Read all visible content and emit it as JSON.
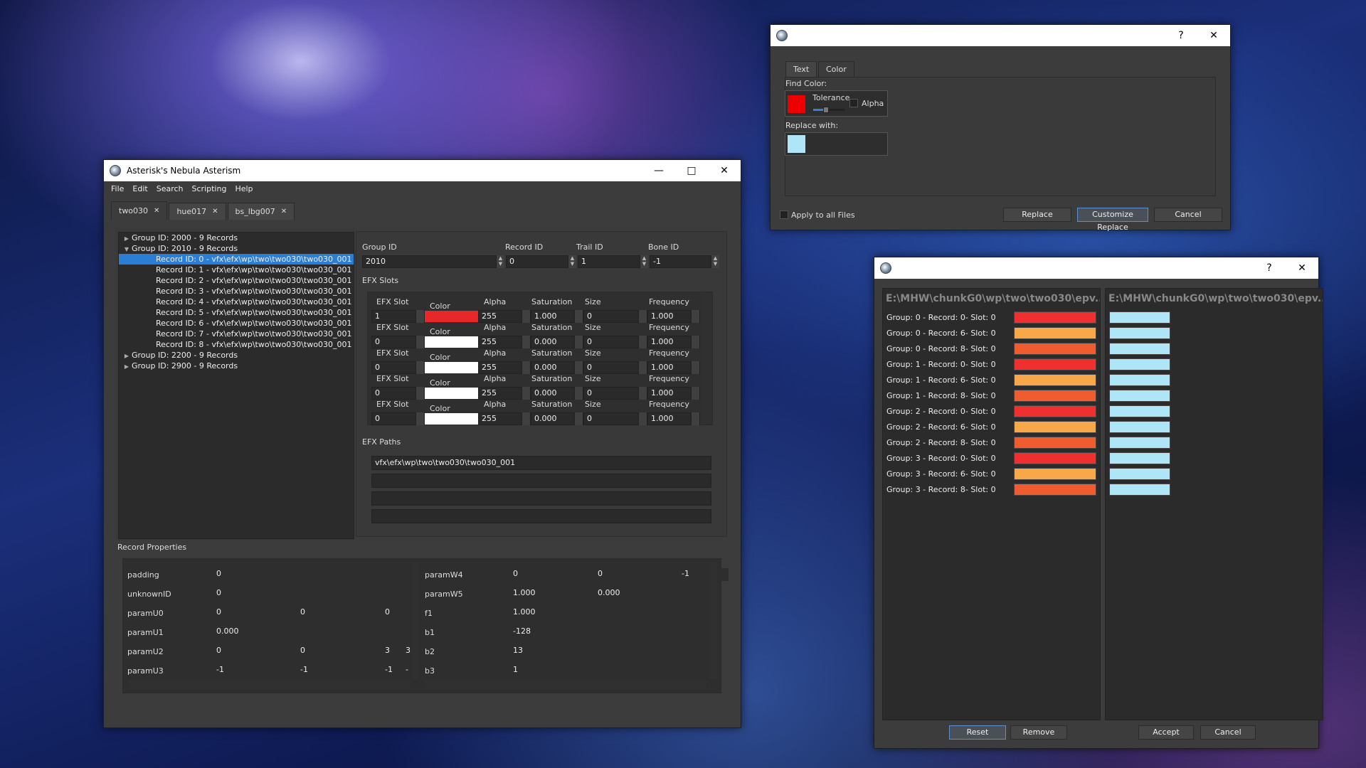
{
  "main": {
    "title": "Asterisk's Nebula Asterism",
    "menu": [
      "File",
      "Edit",
      "Search",
      "Scripting",
      "Help"
    ],
    "tabs": [
      "two030",
      "hue017",
      "bs_lbg007"
    ],
    "tree": [
      {
        "label": "Group ID: 2000 - 9 Records",
        "arrow": "▶",
        "indent": 0
      },
      {
        "label": "Group ID: 2010 - 9 Records",
        "arrow": "▼",
        "indent": 0
      },
      {
        "label": "Record ID: 0 - vfx\\efx\\wp\\two\\two030\\two030_001",
        "arrow": "",
        "indent": 1,
        "sel": true
      },
      {
        "label": "Record ID: 1 - vfx\\efx\\wp\\two\\two030\\two030_001",
        "arrow": "",
        "indent": 1
      },
      {
        "label": "Record ID: 2 - vfx\\efx\\wp\\two\\two030\\two030_001",
        "arrow": "",
        "indent": 1
      },
      {
        "label": "Record ID: 3 - vfx\\efx\\wp\\two\\two030\\two030_001",
        "arrow": "",
        "indent": 1
      },
      {
        "label": "Record ID: 4 - vfx\\efx\\wp\\two\\two030\\two030_001",
        "arrow": "",
        "indent": 1
      },
      {
        "label": "Record ID: 5 - vfx\\efx\\wp\\two\\two030\\two030_001",
        "arrow": "",
        "indent": 1
      },
      {
        "label": "Record ID: 6 - vfx\\efx\\wp\\two\\two030\\two030_001",
        "arrow": "",
        "indent": 1
      },
      {
        "label": "Record ID: 7 - vfx\\efx\\wp\\two\\two030\\two030_001",
        "arrow": "",
        "indent": 1
      },
      {
        "label": "Record ID: 8 - vfx\\efx\\wp\\two\\two030\\two030_001",
        "arrow": "",
        "indent": 1
      },
      {
        "label": "Group ID: 2200 - 9 Records",
        "arrow": "▶",
        "indent": 0
      },
      {
        "label": "Group ID: 2900 - 9 Records",
        "arrow": "▶",
        "indent": 0
      }
    ],
    "ids": {
      "group_label": "Group ID",
      "record_label": "Record ID",
      "trail_label": "Trail ID",
      "bone_label": "Bone ID",
      "group": "2010",
      "record": "0",
      "trail": "1",
      "bone": "-1"
    },
    "efx_slots_title": "EFX Slots",
    "slot_headers": {
      "slot": "EFX Slot",
      "color": "Color",
      "alpha": "Alpha",
      "saturation": "Saturation",
      "size": "Size",
      "frequency": "Frequency"
    },
    "slots": [
      {
        "slot": "1",
        "color": "#e8272a",
        "alpha": "255",
        "saturation": "1.000",
        "size": "0",
        "frequency": "1.000"
      },
      {
        "slot": "0",
        "color": "#ffffff",
        "alpha": "255",
        "saturation": "0.000",
        "size": "0",
        "frequency": "1.000"
      },
      {
        "slot": "0",
        "color": "#ffffff",
        "alpha": "255",
        "saturation": "0.000",
        "size": "0",
        "frequency": "1.000"
      },
      {
        "slot": "0",
        "color": "#ffffff",
        "alpha": "255",
        "saturation": "0.000",
        "size": "0",
        "frequency": "1.000"
      },
      {
        "slot": "0",
        "color": "#ffffff",
        "alpha": "255",
        "saturation": "0.000",
        "size": "0",
        "frequency": "1.000"
      }
    ],
    "efx_paths_title": "EFX Paths",
    "paths": [
      "vfx\\efx\\wp\\two\\two030\\two030_001",
      "",
      "",
      ""
    ],
    "record_props_title": "Record Properties",
    "props_left": [
      {
        "name": "padding",
        "vals": [
          "0"
        ]
      },
      {
        "name": "unknownID",
        "vals": [
          "0"
        ]
      },
      {
        "name": "paramU0",
        "vals": [
          "0",
          "0",
          "0"
        ]
      },
      {
        "name": "paramU1",
        "vals": [
          "0.000"
        ]
      },
      {
        "name": "paramU2",
        "vals": [
          "0",
          "0",
          "3",
          "3"
        ]
      },
      {
        "name": "paramU3",
        "vals": [
          "-1",
          "-1",
          "-1",
          "-"
        ]
      }
    ],
    "props_right": [
      {
        "name": "paramW4",
        "vals": [
          "0",
          "0",
          "-1"
        ]
      },
      {
        "name": "paramW5",
        "vals": [
          "1.000",
          "0.000"
        ]
      },
      {
        "name": "f1",
        "vals": [
          "1.000"
        ]
      },
      {
        "name": "b1",
        "vals": [
          "-128"
        ]
      },
      {
        "name": "b2",
        "vals": [
          "13"
        ]
      },
      {
        "name": "b3",
        "vals": [
          "1"
        ]
      }
    ]
  },
  "find_dialog": {
    "help": "?",
    "close": "✕",
    "tabs": [
      "Text",
      "Color"
    ],
    "find_color_label": "Find Color:",
    "find_color": "#ee0000",
    "tolerance_label": "Tolerance",
    "tolerance_level": 0.4,
    "alpha_label": "Alpha",
    "replace_with_label": "Replace with:",
    "replace_color": "#aee6f8",
    "apply_all_label": "Apply to all Files",
    "replace_btn": "Replace",
    "customize_btn": "Customize Replace",
    "cancel_btn": "Cancel"
  },
  "replace_dialog": {
    "help": "?",
    "close": "✕",
    "left_header": "E:\\MHW\\chunkG0\\wp\\two\\two030\\epv...",
    "right_header": "E:\\MHW\\chunkG0\\wp\\two\\two030\\epv...",
    "rows": [
      {
        "label": "Group: 0 - Record: 0- Slot: 0",
        "color": "#f03030"
      },
      {
        "label": "Group: 0 - Record: 6- Slot: 0",
        "color": "#f8a848"
      },
      {
        "label": "Group: 0 - Record: 8- Slot: 0",
        "color": "#ee5c30"
      },
      {
        "label": "Group: 1 - Record: 0- Slot: 0",
        "color": "#f03030"
      },
      {
        "label": "Group: 1 - Record: 6- Slot: 0",
        "color": "#f8a848"
      },
      {
        "label": "Group: 1 - Record: 8- Slot: 0",
        "color": "#ee5c30"
      },
      {
        "label": "Group: 2 - Record: 0- Slot: 0",
        "color": "#f03030"
      },
      {
        "label": "Group: 2 - Record: 6- Slot: 0",
        "color": "#f8a848"
      },
      {
        "label": "Group: 2 - Record: 8- Slot: 0",
        "color": "#ee5c30"
      },
      {
        "label": "Group: 3 - Record: 0- Slot: 0",
        "color": "#f03030"
      },
      {
        "label": "Group: 3 - Record: 6- Slot: 0",
        "color": "#f8a848"
      },
      {
        "label": "Group: 3 - Record: 8- Slot: 0",
        "color": "#ee5c30"
      }
    ],
    "replace_color": "#aee6f8",
    "reset_btn": "Reset",
    "remove_btn": "Remove",
    "accept_btn": "Accept",
    "cancel_btn": "Cancel"
  }
}
